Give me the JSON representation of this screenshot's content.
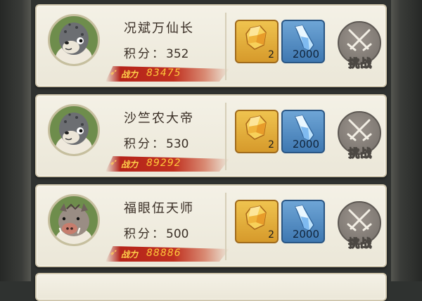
{
  "entries": [
    {
      "name": "况斌万仙长",
      "score_label": "积分：",
      "score": "352",
      "power_label": "战力",
      "power": "83475",
      "avatar": "seal-icon",
      "rewards": [
        {
          "icon": "gold-ore-icon",
          "count": "2"
        },
        {
          "icon": "blue-crystal-icon",
          "count": "2000"
        }
      ],
      "action": "挑战"
    },
    {
      "name": "沙竺农大帝",
      "score_label": "积分：",
      "score": "530",
      "power_label": "战力",
      "power": "89292",
      "avatar": "seal-icon",
      "rewards": [
        {
          "icon": "gold-ore-icon",
          "count": "2"
        },
        {
          "icon": "blue-crystal-icon",
          "count": "2000"
        }
      ],
      "action": "挑战"
    },
    {
      "name": "福眼伍天师",
      "score_label": "积分：",
      "score": "500",
      "power_label": "战力",
      "power": "88886",
      "avatar": "boar-icon",
      "rewards": [
        {
          "icon": "gold-ore-icon",
          "count": "2"
        },
        {
          "icon": "blue-crystal-icon",
          "count": "2000"
        }
      ],
      "action": "挑战"
    }
  ],
  "colors": {
    "card_bg": "#f0ede2",
    "power_band": "#b5241a",
    "power_text": "#ffc93c",
    "gold_tile": "#e2ae3c",
    "blue_tile": "#4f88c0",
    "avatar_bg": "#6e8d4c"
  }
}
